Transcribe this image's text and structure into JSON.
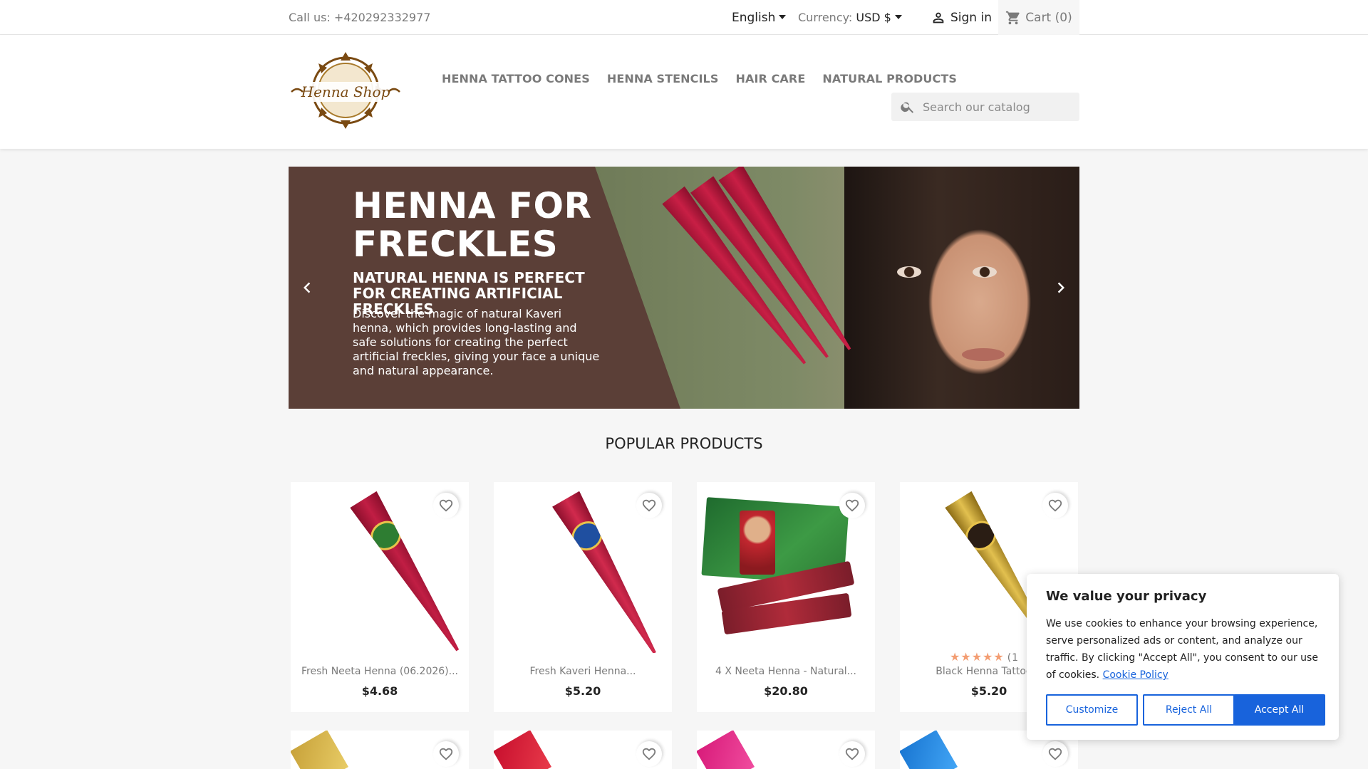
{
  "topbar": {
    "call": "Call us: +420292332977",
    "language": "English",
    "currency_label": "Currency:",
    "currency_value": "USD $",
    "signin": "Sign in",
    "cart": "Cart (0)"
  },
  "header": {
    "logo_text": "Henna Shop",
    "nav": [
      "HENNA TATTOO CONES",
      "HENNA STENCILS",
      "HAIR CARE",
      "NATURAL PRODUCTS"
    ],
    "search_placeholder": "Search our catalog"
  },
  "banner": {
    "title": "HENNA FOR FRECKLES",
    "subtitle": "NATURAL HENNA IS PERFECT FOR CREATING ARTIFICIAL FRECKLES",
    "description": "Discover the magic of natural Kaveri henna, which provides long-lasting and safe solutions for creating the perfect artificial freckles, giving your face a unique and natural appearance."
  },
  "section_title": "POPULAR PRODUCTS",
  "products": [
    {
      "name": "Fresh Neeta Henna (06.2026)...",
      "price": "$4.68"
    },
    {
      "name": "Fresh Kaveri Henna...",
      "price": "$5.20"
    },
    {
      "name": "4 X Neeta Henna - Natural...",
      "price": "$20.80"
    },
    {
      "name": "Black Henna Tattoo C",
      "price": "$5.20",
      "rating": "★★★★★",
      "rating_count": "(1"
    }
  ],
  "cookie": {
    "title": "We value your privacy",
    "text": "We use cookies to enhance your browsing experience, serve personalized ads or content, and analyze our traffic. By clicking \"Accept All\", you consent to our use of cookies.",
    "policy_link": "Cookie Policy",
    "customize": "Customize",
    "reject": "Reject All",
    "accept": "Accept All"
  },
  "colors": {
    "accent": "#1863dc",
    "banner_bg": "#5b3f37",
    "star": "#f39d72",
    "logo_brown": "#7a4a12"
  },
  "icons": [
    "person-icon",
    "cart-icon",
    "search-icon",
    "chevron-left-icon",
    "chevron-right-icon",
    "heart-icon"
  ]
}
